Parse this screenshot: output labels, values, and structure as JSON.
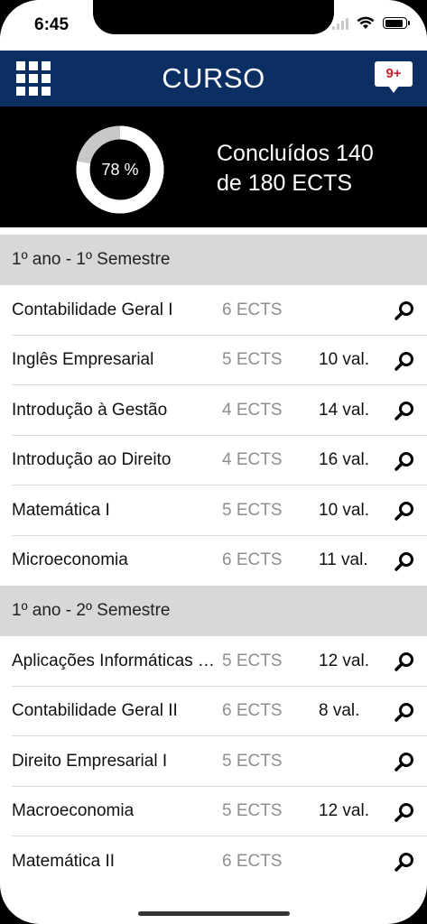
{
  "status": {
    "time": "6:45"
  },
  "header": {
    "title": "CURSO",
    "notifications": "9+"
  },
  "progress": {
    "percent_label": "78 %",
    "fraction": 0.78,
    "line1": "Concluídos 140",
    "line2": "de 180 ECTS"
  },
  "semesters": [
    {
      "title": "1º ano - 1º Semestre",
      "courses": [
        {
          "name": "Contabilidade Geral I",
          "ects": "6 ECTS",
          "grade": ""
        },
        {
          "name": "Inglês Empresarial",
          "ects": "5 ECTS",
          "grade": "10 val."
        },
        {
          "name": "Introdução à Gestão",
          "ects": "4 ECTS",
          "grade": "14 val."
        },
        {
          "name": "Introdução ao Direito",
          "ects": "4 ECTS",
          "grade": "16 val."
        },
        {
          "name": "Matemática I",
          "ects": "5 ECTS",
          "grade": "10 val."
        },
        {
          "name": "Microeconomia",
          "ects": "6 ECTS",
          "grade": "11 val."
        }
      ]
    },
    {
      "title": "1º ano - 2º Semestre",
      "courses": [
        {
          "name": "Aplicações Informáticas para a Gestão",
          "ects": "5 ECTS",
          "grade": "12 val."
        },
        {
          "name": "Contabilidade Geral II",
          "ects": "6 ECTS",
          "grade": "8 val."
        },
        {
          "name": "Direito Empresarial I",
          "ects": "5 ECTS",
          "grade": ""
        },
        {
          "name": "Macroeconomia",
          "ects": "5 ECTS",
          "grade": "12 val."
        },
        {
          "name": "Matemática II",
          "ects": "6 ECTS",
          "grade": ""
        }
      ]
    }
  ],
  "colors": {
    "header_bg": "#0b2e63",
    "badge_text": "#c9202a",
    "donut_track": "#c8c8c8",
    "donut_fill": "#ffffff"
  }
}
